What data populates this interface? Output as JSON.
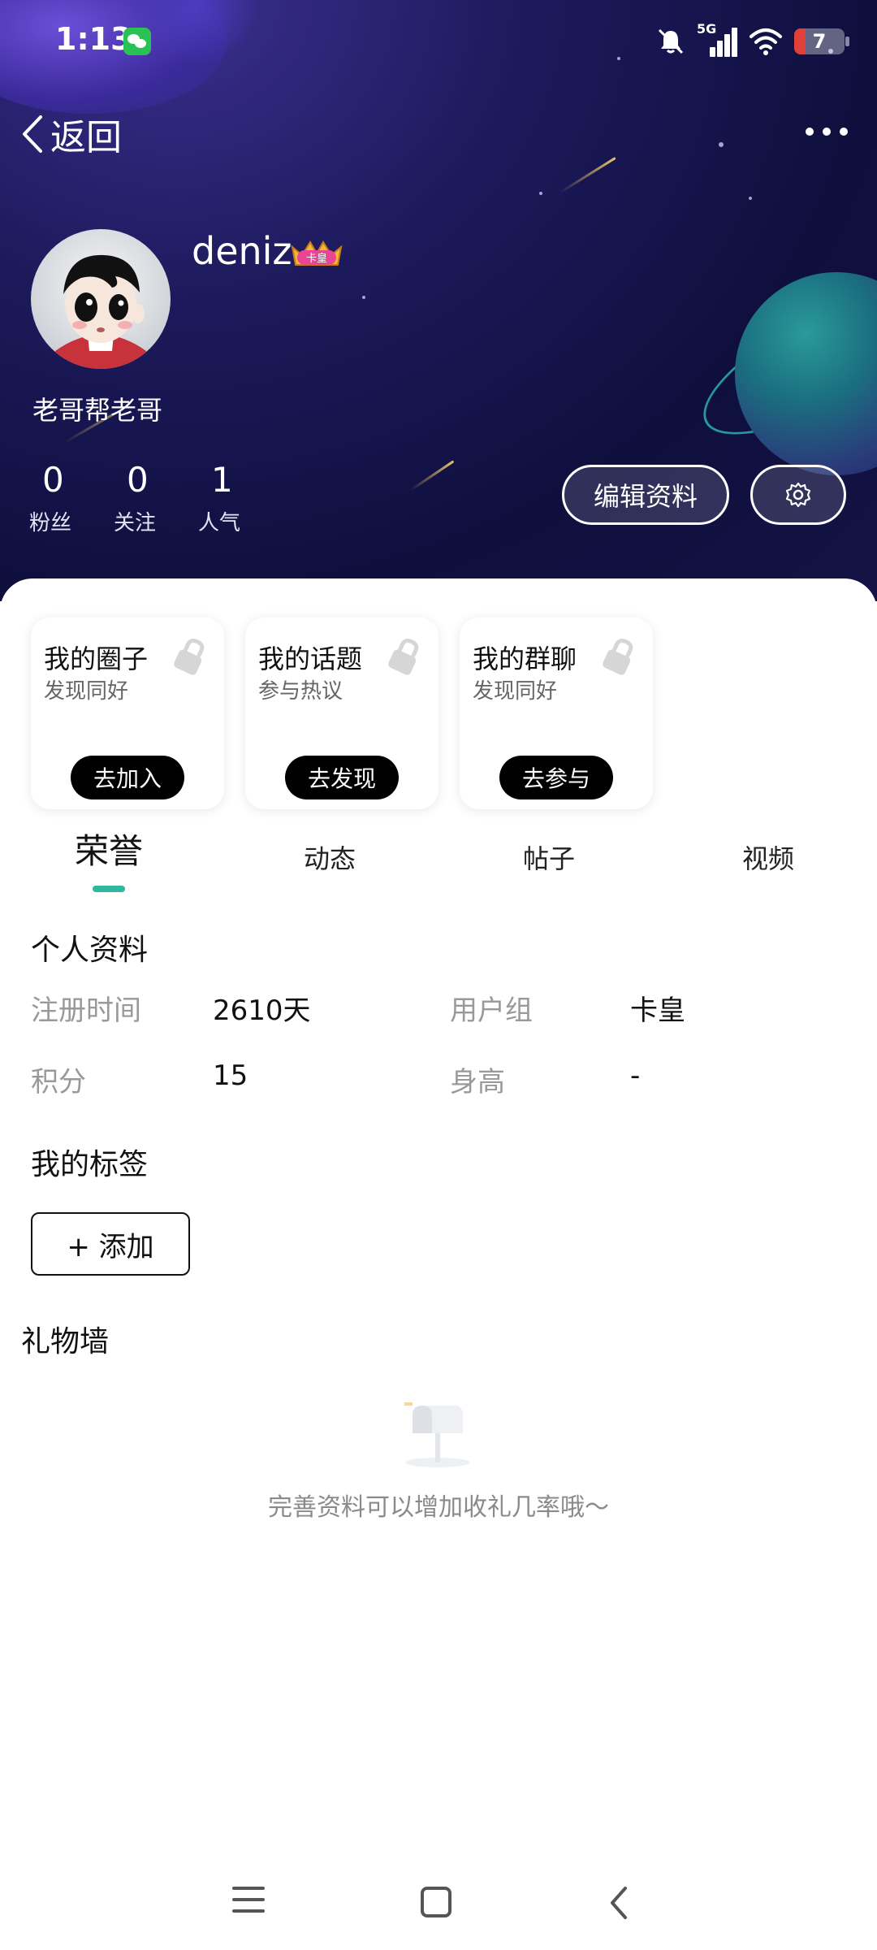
{
  "status_bar": {
    "time": "1:13",
    "network": "5G",
    "battery": "7"
  },
  "nav": {
    "back_label": "返回"
  },
  "profile": {
    "username": "deniz",
    "badge": "卡皇",
    "signature": "老哥帮老哥",
    "stats": [
      {
        "value": "0",
        "label": "粉丝"
      },
      {
        "value": "0",
        "label": "关注"
      },
      {
        "value": "1",
        "label": "人气"
      }
    ],
    "edit_button": "编辑资料"
  },
  "cards": [
    {
      "title": "我的圈子",
      "subtitle": "发现同好",
      "button": "去加入"
    },
    {
      "title": "我的话题",
      "subtitle": "参与热议",
      "button": "去发现"
    },
    {
      "title": "我的群聊",
      "subtitle": "发现同好",
      "button": "去参与"
    }
  ],
  "tabs": [
    {
      "label": "荣誉",
      "active": true
    },
    {
      "label": "动态",
      "active": false
    },
    {
      "label": "帖子",
      "active": false
    },
    {
      "label": "视频",
      "active": false
    }
  ],
  "personal_info": {
    "title": "个人资料",
    "fields": [
      {
        "label": "注册时间",
        "value": "2610天"
      },
      {
        "label": "用户组",
        "value": "卡皇"
      },
      {
        "label": "积分",
        "value": "15"
      },
      {
        "label": "身高",
        "value": "-"
      }
    ]
  },
  "tags": {
    "title": "我的标签",
    "add_button": "+ 添加"
  },
  "gift_wall": {
    "title": "礼物墙",
    "empty_text": "完善资料可以增加收礼几率哦～"
  },
  "colors": {
    "accent": "#2fb7a0",
    "header_bg": "#141344"
  }
}
